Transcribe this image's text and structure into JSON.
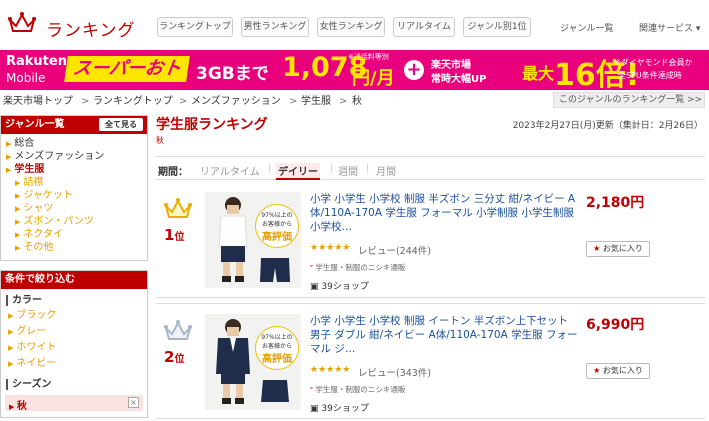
{
  "header": {
    "title": "ランキング",
    "nav_buttons": [
      "ランキングトップ",
      "男性ランキング",
      "女性ランキング",
      "リアルタイム",
      "ジャンル別1位"
    ],
    "links": [
      "ジャンル一覧",
      "関連サービス ▾"
    ]
  },
  "banner": {
    "logo_line1": "Rakuten",
    "logo_line2": "Mobile",
    "super": "スーパーおトク",
    "gb": "3GBまで",
    "price": "1,078",
    "unit": "円/月",
    "note": "※通話料等別",
    "plus": "+",
    "market1": "楽天市場",
    "market2": "常時大幅UP",
    "max": "最大",
    "times": "16倍!",
    "dia1": "※ダイヤモンド会員か",
    "dia2": "全SPU条件達成時"
  },
  "breadcrumb": {
    "items": [
      "楽天市場トップ",
      "ランキングトップ",
      "メンズファッション",
      "学生服",
      "秋"
    ],
    "sep": ">",
    "genre_link": "このジャンルのランキング一覧 >>"
  },
  "sidebar": {
    "genre_head": "ジャンル一覧",
    "see_all": "全て見る",
    "genres": [
      "総合",
      "メンズファッション",
      "学生服",
      "詰襟",
      "ジャケット",
      "シャツ",
      "ズボン・パンツ",
      "ネクタイ",
      "その他"
    ],
    "filter_head": "条件で絞り込む",
    "color_label": "カラー",
    "colors": [
      "ブラック",
      "グレー",
      "ホワイト",
      "ネイビー"
    ],
    "season_label": "シーズン",
    "season_value": "秋",
    "clear": "×"
  },
  "main": {
    "title": "学生服ランキング",
    "subtitle": "秋",
    "updated": "2023年2月27日(月)更新（集計日：2月26日）",
    "period_label": "期間：",
    "periods": [
      "リアルタイム",
      "デイリー",
      "週間",
      "月間"
    ],
    "items": [
      {
        "rank": "1",
        "rank_suffix": "位",
        "title": "小学 小学生 小学校 制服 半ズボン 三分丈 紺/ネイビー A体/110A-170A 学生服 フォーマル 小学制服 小学生制服 小学校…",
        "price": "2,180円",
        "stars": "★★★★★",
        "review": "レビュー(244件)",
        "shop": "学生服・制服のニシキ通販",
        "shops": "39ショップ",
        "fav": "お気に入り",
        "badge_top": "97%以上の",
        "badge_mid": "お客様から",
        "badge_bot": "高評価"
      },
      {
        "rank": "2",
        "rank_suffix": "位",
        "title": "小学 小学生 小学校 制服 イートン 半ズボン上下セット 男子 ダブル 紺/ネイビー A体/110A-170A 学生服 フォーマル ジ…",
        "price": "6,990円",
        "stars": "★★★★★",
        "review": "レビュー(343件)",
        "shop": "学生服・制服のニシキ通販",
        "shops": "39ショップ",
        "fav": "お気に入り",
        "badge_top": "97%以上の",
        "badge_mid": "お客様から",
        "badge_bot": "高評価"
      }
    ]
  },
  "colors": {
    "accent": "#bf0000",
    "banner": "#e8007d",
    "gold": "#e8a000",
    "link": "#1a4e9e"
  }
}
